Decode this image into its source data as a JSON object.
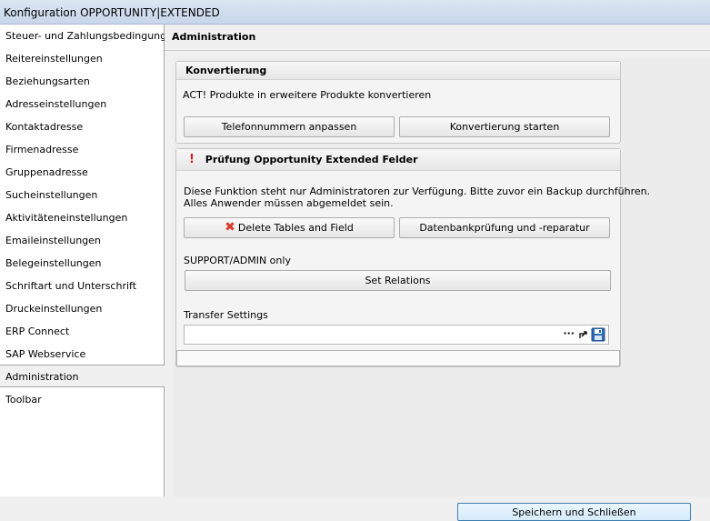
{
  "window": {
    "title": "Konfiguration OPPORTUNITY|EXTENDED"
  },
  "sidebar": {
    "items": [
      {
        "label": "Steuer- und Zahlungsbedingungen"
      },
      {
        "label": "Reitereinstellungen"
      },
      {
        "label": "Beziehungsarten"
      },
      {
        "label": "Adresseinstellungen"
      },
      {
        "label": "Kontaktadresse"
      },
      {
        "label": "Firmenadresse"
      },
      {
        "label": "Gruppenadresse"
      },
      {
        "label": "Sucheinstellungen"
      },
      {
        "label": "Aktivitäteneinstellungen"
      },
      {
        "label": "Emaileinstellungen"
      },
      {
        "label": "Belegeinstellungen"
      },
      {
        "label": "Schriftart und Unterschrift"
      },
      {
        "label": "Druckeinstellungen"
      },
      {
        "label": "ERP Connect"
      },
      {
        "label": "SAP Webservice"
      },
      {
        "label": "Administration",
        "selected": true
      },
      {
        "label": "Toolbar"
      }
    ]
  },
  "main": {
    "header": "Administration",
    "konvertierung": {
      "title": "Konvertierung",
      "description": "ACT! Produkte in erweitere Produkte konvertieren",
      "btn_phone": "Telefonnummern anpassen",
      "btn_convert": "Konvertierung starten"
    },
    "pruefung": {
      "title": "Prüfung Opportunity Extended Felder",
      "warn_icon": "exclamation-icon",
      "warn_glyph": "!",
      "desc_line1": "Diese Funktion steht nur Administratoren zur Verfügung. Bitte zuvor ein Backup durchführen.",
      "desc_line2": "Alles Anwender müssen abgemeldet sein.",
      "btn_delete": "Delete Tables and Field",
      "delete_icon": "red-x-icon",
      "delete_glyph": "✖",
      "btn_db_check": "Datenbankprüfung und  -reparatur",
      "support_label": "SUPPORT/ADMIN only",
      "btn_set_relations": "Set Relations",
      "transfer_label": "Transfer Settings",
      "transfer_value": "",
      "ellipsis_glyph": "···"
    }
  },
  "footer": {
    "save_close": "Speichern und Schließen"
  }
}
